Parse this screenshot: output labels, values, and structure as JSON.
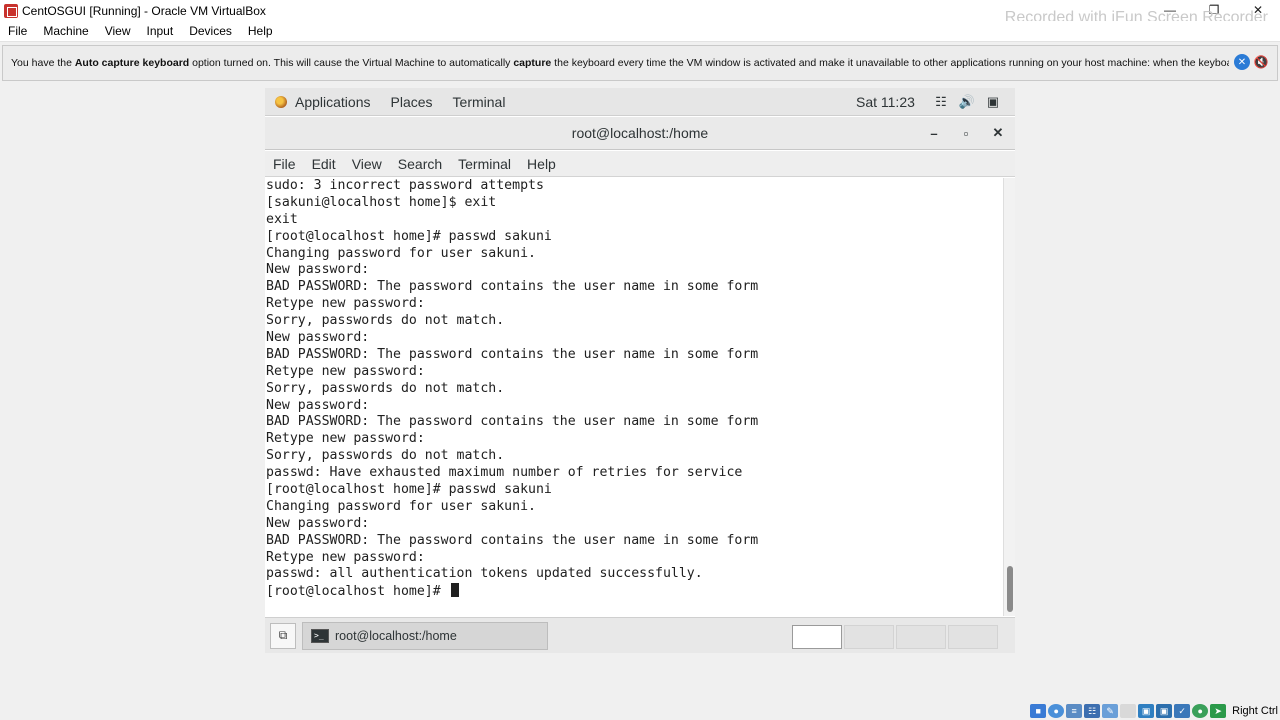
{
  "host": {
    "title": "CentOSGUI [Running] - Oracle VM VirtualBox",
    "watermark": "Recorded with iFun Screen Recorder",
    "menu": [
      "File",
      "Machine",
      "View",
      "Input",
      "Devices",
      "Help"
    ],
    "notice": {
      "p1": "You have the ",
      "b1": "Auto capture keyboard",
      "p2": " option turned on. This will cause the Virtual Machine to automatically ",
      "b2": "capture",
      "p3": " the keyboard every time the VM window is activated and make it unavailable to other applications running on your host machine: when the keyboard is"
    },
    "host_key": "Right Ctrl",
    "status_icons": [
      "hdd-icon",
      "optical-icon",
      "usb-icon",
      "network-icon",
      "shared-folder-icon",
      "display-icon",
      "video-capture-icon",
      "cpu-icon",
      "mouse-icon",
      "arrow-icon"
    ]
  },
  "gnome": {
    "applications": "Applications",
    "places": "Places",
    "terminal": "Terminal",
    "clock": "Sat 11:23"
  },
  "terminal": {
    "title": "root@localhost:/home",
    "menu": [
      "File",
      "Edit",
      "View",
      "Search",
      "Terminal",
      "Help"
    ],
    "lines": [
      "sudo: 3 incorrect password attempts",
      "[sakuni@localhost home]$ exit",
      "exit",
      "[root@localhost home]# passwd sakuni",
      "Changing password for user sakuni.",
      "New password: ",
      "BAD PASSWORD: The password contains the user name in some form",
      "Retype new password: ",
      "Sorry, passwords do not match.",
      "New password: ",
      "BAD PASSWORD: The password contains the user name in some form",
      "Retype new password: ",
      "Sorry, passwords do not match.",
      "New password: ",
      "BAD PASSWORD: The password contains the user name in some form",
      "Retype new password: ",
      "Sorry, passwords do not match.",
      "passwd: Have exhausted maximum number of retries for service",
      "[root@localhost home]# passwd sakuni",
      "Changing password for user sakuni.",
      "New password: ",
      "BAD PASSWORD: The password contains the user name in some form",
      "Retype new password: ",
      "passwd: all authentication tokens updated successfully."
    ],
    "prompt": "[root@localhost home]# "
  },
  "taskbar": {
    "item_label": "root@localhost:/home"
  }
}
